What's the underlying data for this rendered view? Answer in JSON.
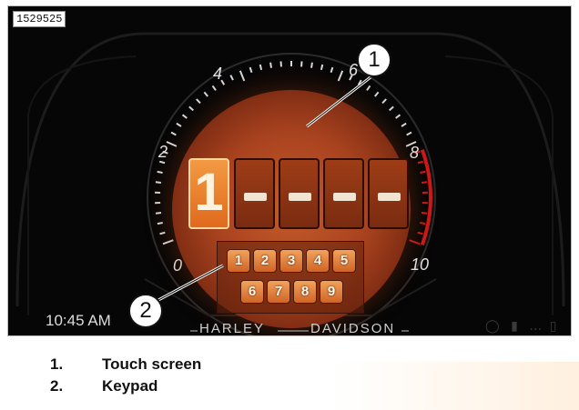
{
  "figure": {
    "photo_id": "1529525",
    "gauge_ticks": [
      "0",
      "2",
      "4",
      "6",
      "8",
      "10"
    ],
    "pin_digits": [
      "1",
      "",
      "",
      "",
      ""
    ],
    "keypad_keys": [
      "1",
      "2",
      "3",
      "4",
      "5",
      "6",
      "7",
      "8",
      "9"
    ],
    "clock": "10:45 AM",
    "brand_left": "HARLEY",
    "brand_right": "DAVIDSON",
    "callouts": [
      "1",
      "2"
    ],
    "status_icons": [
      "phone-icon",
      "bluetooth-icon",
      "signal-icon",
      "battery-icon"
    ],
    "colors": {
      "screen_orange": "#c45b2b",
      "redline": "#d01818",
      "key_orange": "#f2a35b"
    }
  },
  "caption": {
    "items": [
      {
        "number": "1.",
        "label": "Touch screen"
      },
      {
        "number": "2.",
        "label": "Keypad"
      }
    ]
  }
}
